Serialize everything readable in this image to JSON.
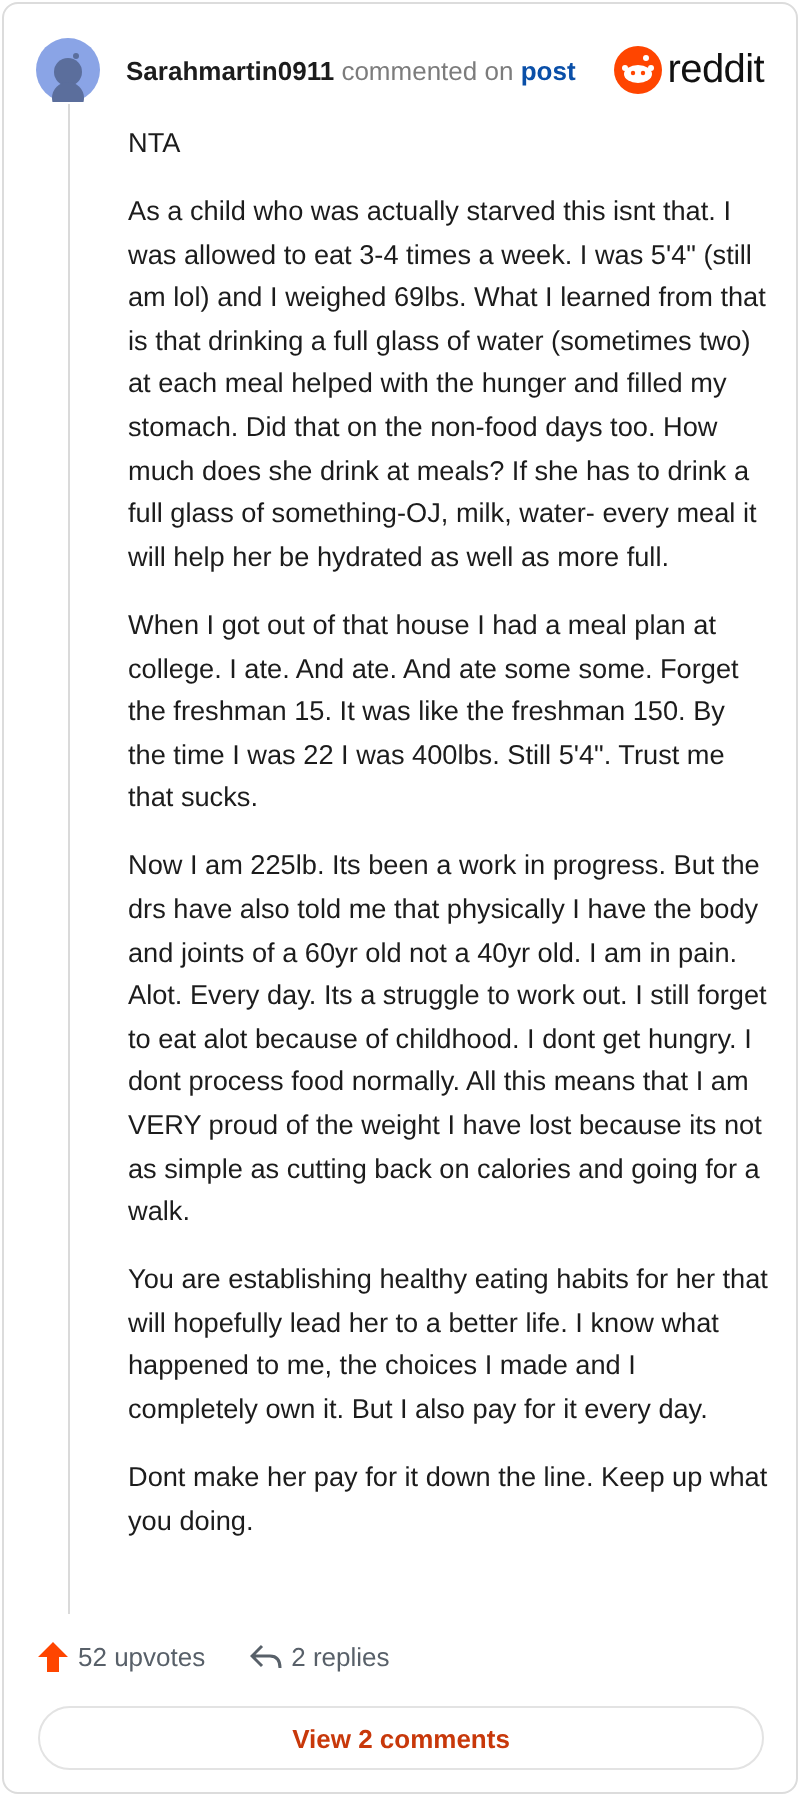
{
  "comment": {
    "author": "Sarahmartin0911",
    "action": "commented on",
    "link": "post",
    "brand": "reddit",
    "paragraphs": [
      "NTA",
      "As a child who was actually starved this isnt that. I was allowed to eat 3-4 times a week. I was 5'4\" (still am lol) and I weighed 69lbs. What I learned from that is that drinking a full glass of water (sometimes two) at each meal helped with the hunger and filled my stomach. Did that on the non-food days too. How much does she drink at meals? If she has to drink a full glass of something-OJ, milk, water- every meal it will help her be hydrated as well as more full.",
      "When I got out of that house I had a meal plan at college. I ate. And ate. And ate some some. Forget the freshman 15. It was like the freshman 150. By the time I was 22 I was 400lbs. Still 5'4\". Trust me that sucks.",
      "Now I am 225lb. Its been a work in progress. But the drs have also told me that physically I have the body and joints of a 60yr old not a 40yr old. I am in pain. Alot. Every day. Its a struggle to work out. I still forget to eat alot because of childhood. I dont get hungry. I dont process food normally. All this means that I am VERY proud of the weight I have lost because its not as simple as cutting back on calories and going for a walk.",
      "You are establishing healthy eating habits for her that will hopefully lead her to a better life. I know what happened to me, the choices I made and I completely own it. But I also pay for it every day.",
      "Dont make her pay for it down the line. Keep up what you doing."
    ],
    "upvotes": "52 upvotes",
    "replies": "2 replies",
    "view_button": "View 2 comments"
  }
}
